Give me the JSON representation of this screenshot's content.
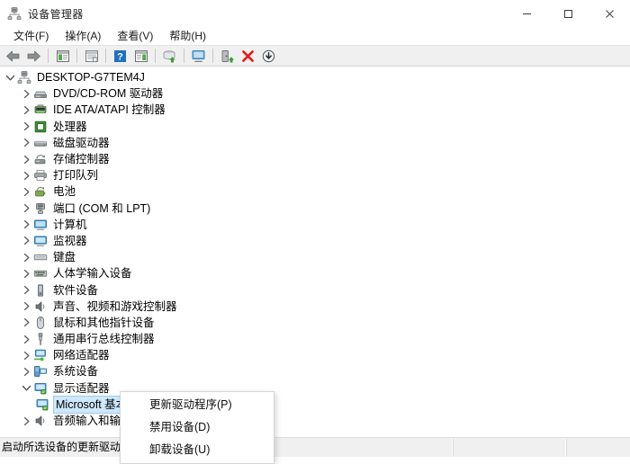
{
  "window": {
    "title": "设备管理器",
    "icon": "device-manager-icon",
    "controls": {
      "minimize": "—",
      "maximize": "□",
      "close": "✕"
    }
  },
  "menubar": {
    "items": [
      {
        "label": "文件(F)",
        "name": "menu-file"
      },
      {
        "label": "操作(A)",
        "name": "menu-action"
      },
      {
        "label": "查看(V)",
        "name": "menu-view"
      },
      {
        "label": "帮助(H)",
        "name": "menu-help"
      }
    ]
  },
  "toolbar": {
    "buttons": [
      {
        "icon": "back-arrow-icon",
        "name": "toolbar-back"
      },
      {
        "icon": "forward-arrow-icon",
        "name": "toolbar-forward"
      },
      {
        "sep": true
      },
      {
        "icon": "show-hide-console-tree-icon",
        "name": "toolbar-console-tree"
      },
      {
        "sep": true
      },
      {
        "icon": "properties-icon",
        "name": "toolbar-properties"
      },
      {
        "sep": true
      },
      {
        "icon": "help-icon",
        "name": "toolbar-help"
      },
      {
        "icon": "show-hide-action-pane-icon",
        "name": "toolbar-action-pane"
      },
      {
        "sep": true
      },
      {
        "icon": "scan-hardware-changes-icon",
        "name": "toolbar-scan-hardware"
      },
      {
        "sep": true
      },
      {
        "icon": "update-driver-icon",
        "name": "toolbar-update-driver"
      },
      {
        "sep": true
      },
      {
        "icon": "disable-device-icon",
        "name": "toolbar-disable-device"
      },
      {
        "icon": "uninstall-device-icon",
        "name": "toolbar-uninstall-device"
      },
      {
        "icon": "install-legacy-hardware-icon",
        "name": "toolbar-install-hardware"
      }
    ]
  },
  "tree": {
    "nodes": [
      {
        "label": "DESKTOP-G7TEM4J",
        "level": 0,
        "expanded": true,
        "icon": "computer-root-icon",
        "name": "tree-node-desktop-g7tem4j"
      },
      {
        "label": "DVD/CD-ROM 驱动器",
        "level": 1,
        "expanded": false,
        "icon": "dvd-drive-icon",
        "name": "tree-node-dvd-cdrom"
      },
      {
        "label": "IDE ATA/ATAPI 控制器",
        "level": 1,
        "expanded": false,
        "icon": "ide-controller-icon",
        "name": "tree-node-ide-ata-atapi"
      },
      {
        "label": "处理器",
        "level": 1,
        "expanded": false,
        "icon": "processor-icon",
        "name": "tree-node-processor"
      },
      {
        "label": "磁盘驱动器",
        "level": 1,
        "expanded": false,
        "icon": "disk-drive-icon",
        "name": "tree-node-disk-drives"
      },
      {
        "label": "存储控制器",
        "level": 1,
        "expanded": false,
        "icon": "storage-controller-icon",
        "name": "tree-node-storage-controllers"
      },
      {
        "label": "打印队列",
        "level": 1,
        "expanded": false,
        "icon": "print-queue-icon",
        "name": "tree-node-print-queues"
      },
      {
        "label": "电池",
        "level": 1,
        "expanded": false,
        "icon": "battery-icon",
        "name": "tree-node-batteries"
      },
      {
        "label": "端口 (COM 和 LPT)",
        "level": 1,
        "expanded": false,
        "icon": "ports-icon",
        "name": "tree-node-ports"
      },
      {
        "label": "计算机",
        "level": 1,
        "expanded": false,
        "icon": "computer-icon",
        "name": "tree-node-computer"
      },
      {
        "label": "监视器",
        "level": 1,
        "expanded": false,
        "icon": "monitor-icon",
        "name": "tree-node-monitors"
      },
      {
        "label": "键盘",
        "level": 1,
        "expanded": false,
        "icon": "keyboard-icon",
        "name": "tree-node-keyboards"
      },
      {
        "label": "人体学输入设备",
        "level": 1,
        "expanded": false,
        "icon": "hid-icon",
        "name": "tree-node-hid"
      },
      {
        "label": "软件设备",
        "level": 1,
        "expanded": false,
        "icon": "software-device-icon",
        "name": "tree-node-software-devices"
      },
      {
        "label": "声音、视频和游戏控制器",
        "level": 1,
        "expanded": false,
        "icon": "sound-video-game-icon",
        "name": "tree-node-sound-video-game"
      },
      {
        "label": "鼠标和其他指针设备",
        "level": 1,
        "expanded": false,
        "icon": "mouse-icon",
        "name": "tree-node-mice"
      },
      {
        "label": "通用串行总线控制器",
        "level": 1,
        "expanded": false,
        "icon": "usb-controller-icon",
        "name": "tree-node-usb-controllers"
      },
      {
        "label": "网络适配器",
        "level": 1,
        "expanded": false,
        "icon": "network-adapter-icon",
        "name": "tree-node-network-adapters"
      },
      {
        "label": "系统设备",
        "level": 1,
        "expanded": false,
        "icon": "system-device-icon",
        "name": "tree-node-system-devices"
      },
      {
        "label": "显示适配器",
        "level": 1,
        "expanded": true,
        "icon": "display-adapter-icon",
        "name": "tree-node-display-adapters"
      },
      {
        "label": "Microsoft 基本显示适配器",
        "level": 2,
        "expanded": null,
        "selected": true,
        "icon": "display-adapter-child-icon",
        "name": "tree-node-microsoft-basic-display-adapter"
      },
      {
        "label": "音频输入和输出",
        "level": 1,
        "expanded": false,
        "icon": "audio-io-icon",
        "name": "tree-node-audio-inputs-outputs"
      }
    ]
  },
  "context_menu": {
    "items": [
      {
        "label": "更新驱动程序(P)",
        "name": "ctx-update-driver"
      },
      {
        "label": "禁用设备(D)",
        "name": "ctx-disable-device"
      },
      {
        "label": "卸载设备(U)",
        "name": "ctx-uninstall-device"
      }
    ]
  },
  "statusbar": {
    "text": "启动所选设备的更新驱动",
    "cell2": "",
    "cell3": ""
  },
  "colors": {
    "selection": "#cde8ff",
    "selection_border": "#9ec9e8",
    "toolbar_bg": "#f0f0f0",
    "statusbar_bg": "#f0f0f0",
    "accent_red": "#e01b1b",
    "accent_green": "#3a9a32",
    "accent_blue": "#1f6fc4"
  }
}
